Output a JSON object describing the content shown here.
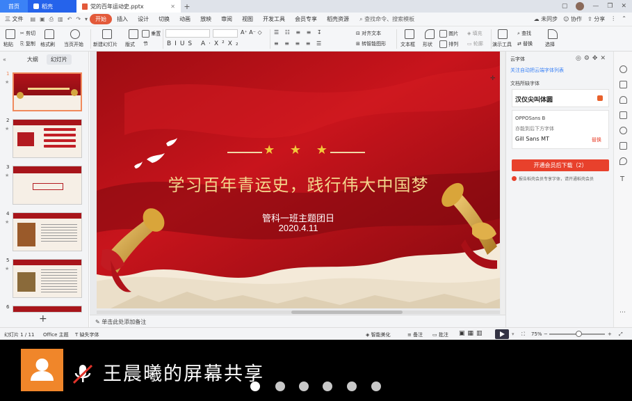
{
  "tabbar": {
    "home_label": "首页",
    "wps_label": "稻壳",
    "doc_title": "党的百年运动史.pptx",
    "new_tab": "+"
  },
  "menu": {
    "file": "三 文件",
    "items": [
      "开始",
      "插入",
      "设计",
      "切换",
      "动画",
      "放映",
      "审阅",
      "视图",
      "开发工具",
      "会员专享",
      "稻壳资源"
    ],
    "active_index": 0,
    "search": "查找命令、搜索模板",
    "right": [
      "未同步",
      "协作",
      "分享"
    ]
  },
  "ribbon": {
    "paste": "粘贴",
    "cut": "剪切",
    "copy": "复制",
    "format_painter": "格式刷",
    "play_from_current": "当页开始",
    "new_slide": "新建幻灯片",
    "layout": "版式",
    "section": "节",
    "reset": "重置",
    "text_box": "文本框",
    "shape": "形状",
    "arrange": "排列",
    "picture": "图片",
    "fill": "填充",
    "outline": "轮廓",
    "find": "查找",
    "replace": "替换",
    "select": "选择",
    "align_text": "对齐文本",
    "convert_smartart": "转智能图形",
    "show_toolbar": "演示工具"
  },
  "left_panel": {
    "tab_outline": "大纲",
    "tab_slides": "幻灯片",
    "slides": [
      {
        "num": "1",
        "selected": true
      },
      {
        "num": "2",
        "selected": false
      },
      {
        "num": "3",
        "selected": false
      },
      {
        "num": "4",
        "selected": false
      },
      {
        "num": "5",
        "selected": false
      },
      {
        "num": "6",
        "selected": false
      }
    ],
    "add_slide": "+"
  },
  "slide": {
    "title": "学习百年青运史，践行伟大中国梦",
    "subtitle": "管科一班主题团日",
    "date": "2020.4.11",
    "stars": "★ ★ ★"
  },
  "notes": {
    "placeholder": "单击此处添加备注"
  },
  "right_panel": {
    "header": "云字体",
    "link": "关注自动把云端字体列表",
    "section": "文档所缺字体",
    "missing_font": "汉仪尖叫体圆",
    "font_1": "OPPOSans B",
    "hint": "亦能到后下方字体",
    "font_2": "Gill Sans MT",
    "font_2_action": "替换",
    "download_button": "开通会员后下载（2）",
    "vip_note": "报告稻壳会员专享字体，请开通稻壳会员"
  },
  "statusbar": {
    "slide_count": "幻灯片 1 / 11",
    "theme": "Office 主题",
    "missing_fonts": "缺失字体",
    "beautify": "智能美化",
    "notes": "备注",
    "comments": "批注",
    "zoom": "75%"
  },
  "sharebar": {
    "presenter": "王晨曦的屏幕共享",
    "dots": 5
  }
}
